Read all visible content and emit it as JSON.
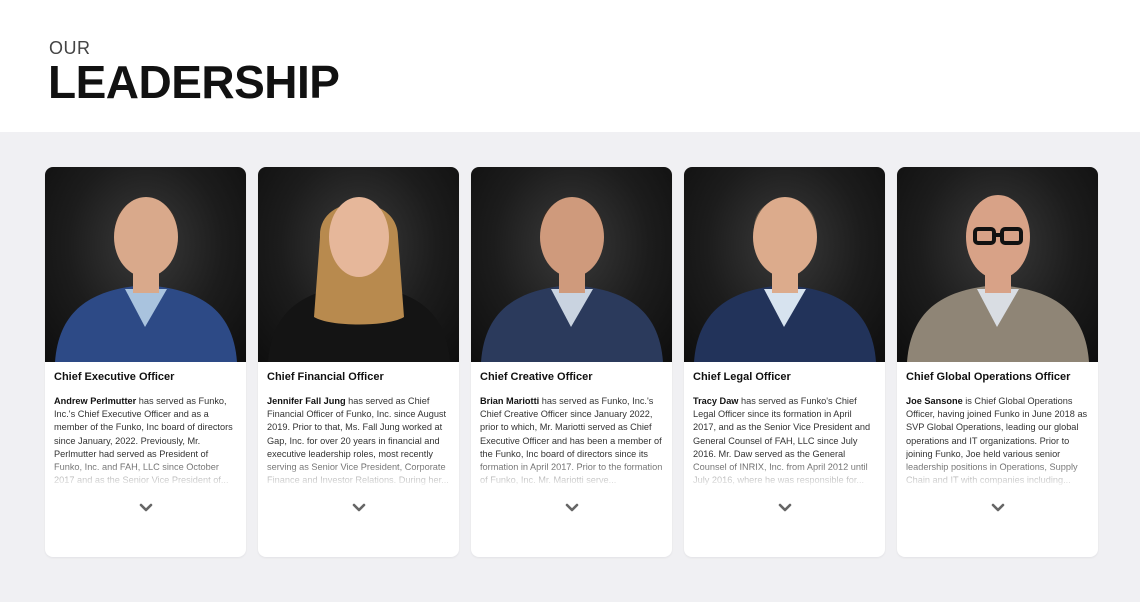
{
  "header": {
    "eyebrow": "OUR",
    "title": "LEADERSHIP"
  },
  "leaders": [
    {
      "role": "Chief Executive Officer",
      "name": "Andrew Perlmutter",
      "bio": " has served as Funko, Inc.'s Chief Executive Officer and as a member of the Funko, Inc board of directors since January, 2022. Previously, Mr. Perlmutter had served as President of Funko, Inc. and FAH, LLC since October 2017 and as the Senior Vice President of...",
      "jacket": "#2d4a86",
      "shirt": "#a9c3de",
      "hair": "#3a2f27",
      "skin": "#d9a98b"
    },
    {
      "role": "Chief Financial Officer",
      "name": "Jennifer Fall Jung",
      "bio": " has served as Chief Financial Officer of Funko, Inc. since August 2019. Prior to that, Ms. Fall Jung worked at Gap, Inc. for over 20 years in financial and executive leadership roles, most recently serving as Senior Vice President, Corporate Finance and Investor Relations. During her...",
      "jacket": "#141414",
      "shirt": "#141414",
      "hair": "#b88a4e",
      "skin": "#e6b79a"
    },
    {
      "role": "Chief Creative Officer",
      "name": "Brian Mariotti",
      "bio": " has served as Funko, Inc.'s Chief Creative Officer since January 2022, prior to which, Mr. Mariotti served as Chief Executive Officer and has been a member of the Funko, Inc board of directors since its formation in April 2017. Prior to the formation of Funko, Inc. Mr. Mariotti serve...",
      "jacket": "#2b3a5c",
      "shirt": "#c9d3e0",
      "hair": "#3b2c22",
      "skin": "#cf9a7c"
    },
    {
      "role": "Chief Legal Officer",
      "name": "Tracy Daw",
      "bio": " has served as Funko's Chief Legal Officer since its formation in April 2017, and as the Senior Vice President and General Counsel of FAH, LLC since July 2016. Mr. Daw served as the General Counsel of INRIX, Inc. from April 2012 until July 2016, where he was responsible for...",
      "jacket": "#22335a",
      "shirt": "#d7e3ef",
      "hair": "#6b5a48",
      "skin": "#dcab8c"
    },
    {
      "role": "Chief Global Operations Officer",
      "name": "Joe Sansone",
      "bio": " is Chief Global Operations Officer, having joined Funko in June 2018 as SVP Global Operations, leading our global operations and IT organizations. Prior to joining Funko, Joe held various senior leadership positions in Operations, Supply Chain and IT with companies including...",
      "jacket": "#8f8576",
      "shirt": "#d9dde3",
      "hair": "#d4a690",
      "skin": "#d8a287"
    }
  ],
  "icons": {
    "expand": "chevron-down-icon"
  }
}
